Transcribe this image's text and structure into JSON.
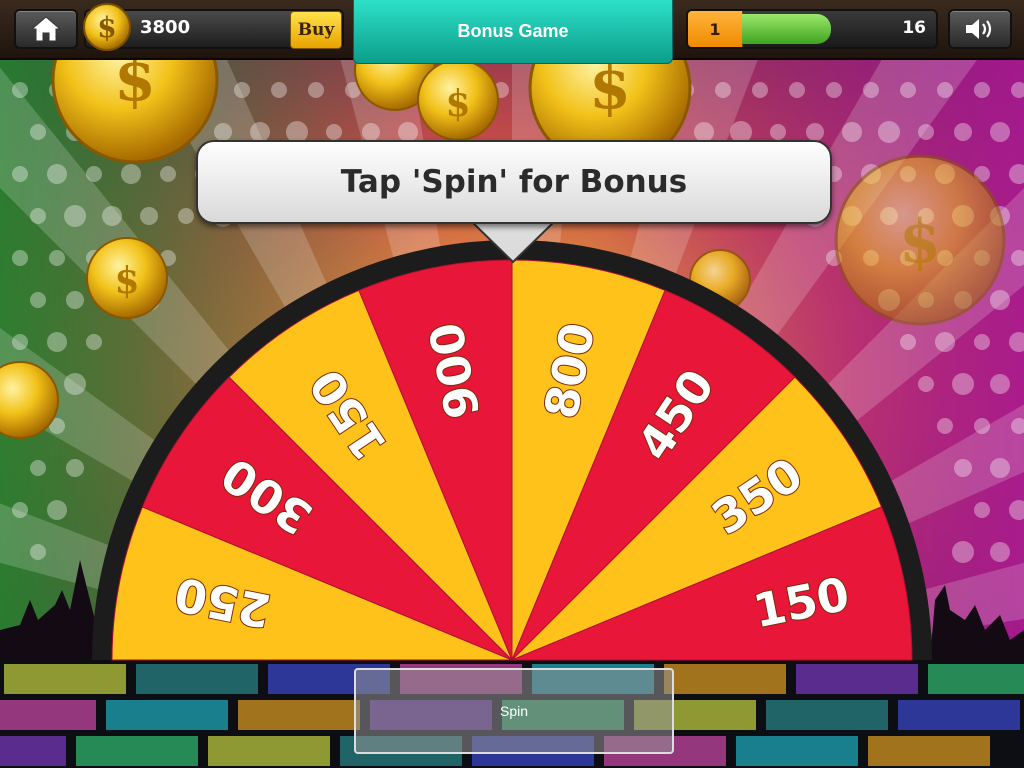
{
  "header": {
    "home_icon": "home-icon",
    "coin_icon": "dollar-coin-icon",
    "coins": "3800",
    "buy_label": "Buy",
    "title": "Bonus Game",
    "level": "1",
    "xp_progress": 0.47,
    "xp_value": "16",
    "sound_icon": "speaker-icon"
  },
  "prompt": "Tap 'Spin' for Bonus",
  "wheel": {
    "segments": [
      "250",
      "300",
      "150",
      "900",
      "800",
      "450",
      "350",
      "150"
    ],
    "colors": [
      "#ffc21a",
      "#e8173a"
    ]
  },
  "spin_label": "Spin"
}
